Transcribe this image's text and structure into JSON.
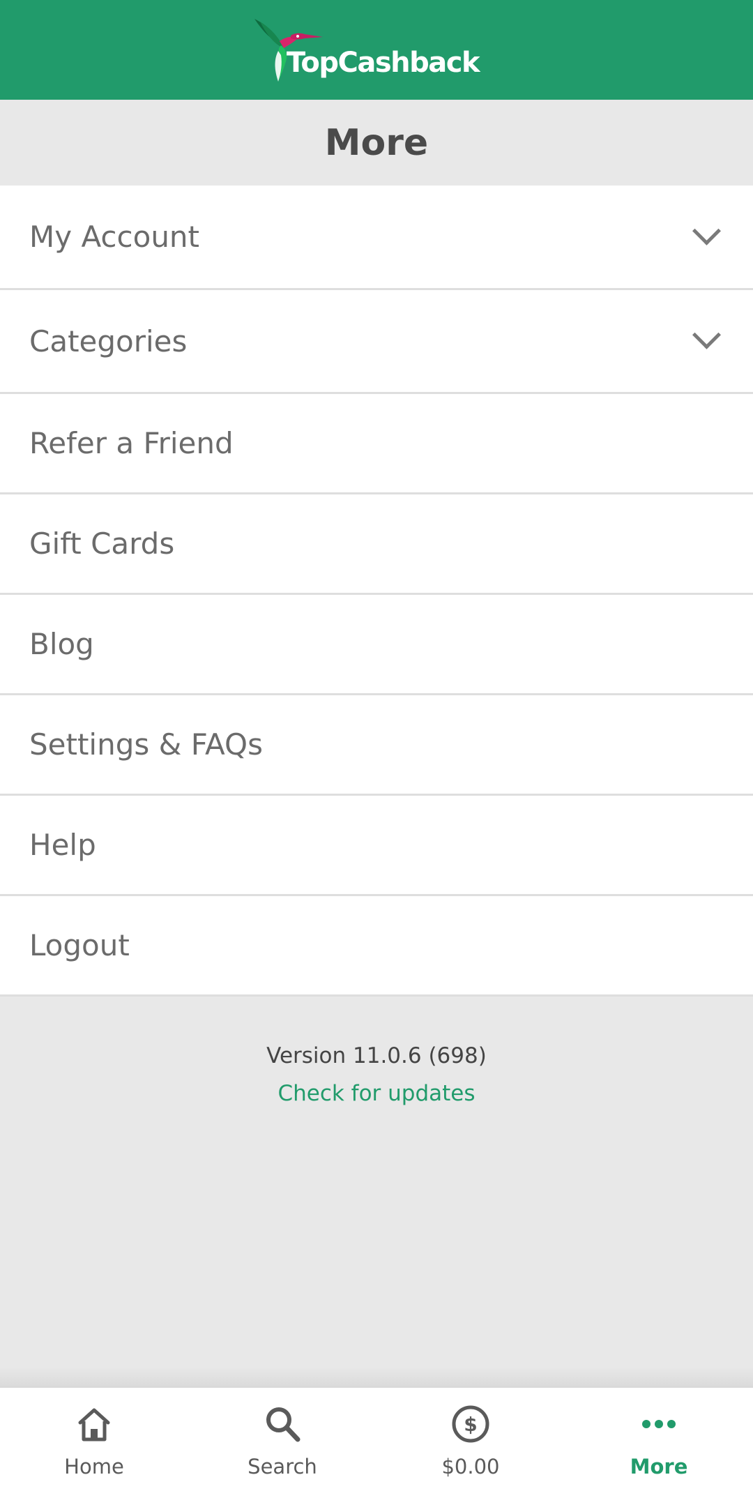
{
  "header": {
    "brand": "TopCashback",
    "brand_color": "#219b6b"
  },
  "page": {
    "title": "More"
  },
  "menu": {
    "items": [
      {
        "label": "My Account",
        "expandable": true
      },
      {
        "label": "Categories",
        "expandable": true
      },
      {
        "label": "Refer a Friend",
        "expandable": false
      },
      {
        "label": "Gift Cards",
        "expandable": false
      },
      {
        "label": "Blog",
        "expandable": false
      },
      {
        "label": "Settings & FAQs",
        "expandable": false
      },
      {
        "label": "Help",
        "expandable": false
      },
      {
        "label": "Logout",
        "expandable": false
      }
    ]
  },
  "footer": {
    "version": "Version 11.0.6 (698)",
    "check_updates": "Check for updates"
  },
  "tabbar": {
    "tabs": [
      {
        "label": "Home",
        "icon": "home-icon",
        "active": false
      },
      {
        "label": "Search",
        "icon": "search-icon",
        "active": false
      },
      {
        "label": "$0.00",
        "icon": "dollar-circle-icon",
        "active": false
      },
      {
        "label": "More",
        "icon": "more-dots-icon",
        "active": true
      }
    ],
    "active_color": "#219b6b",
    "inactive_color": "#5a5a5a"
  }
}
